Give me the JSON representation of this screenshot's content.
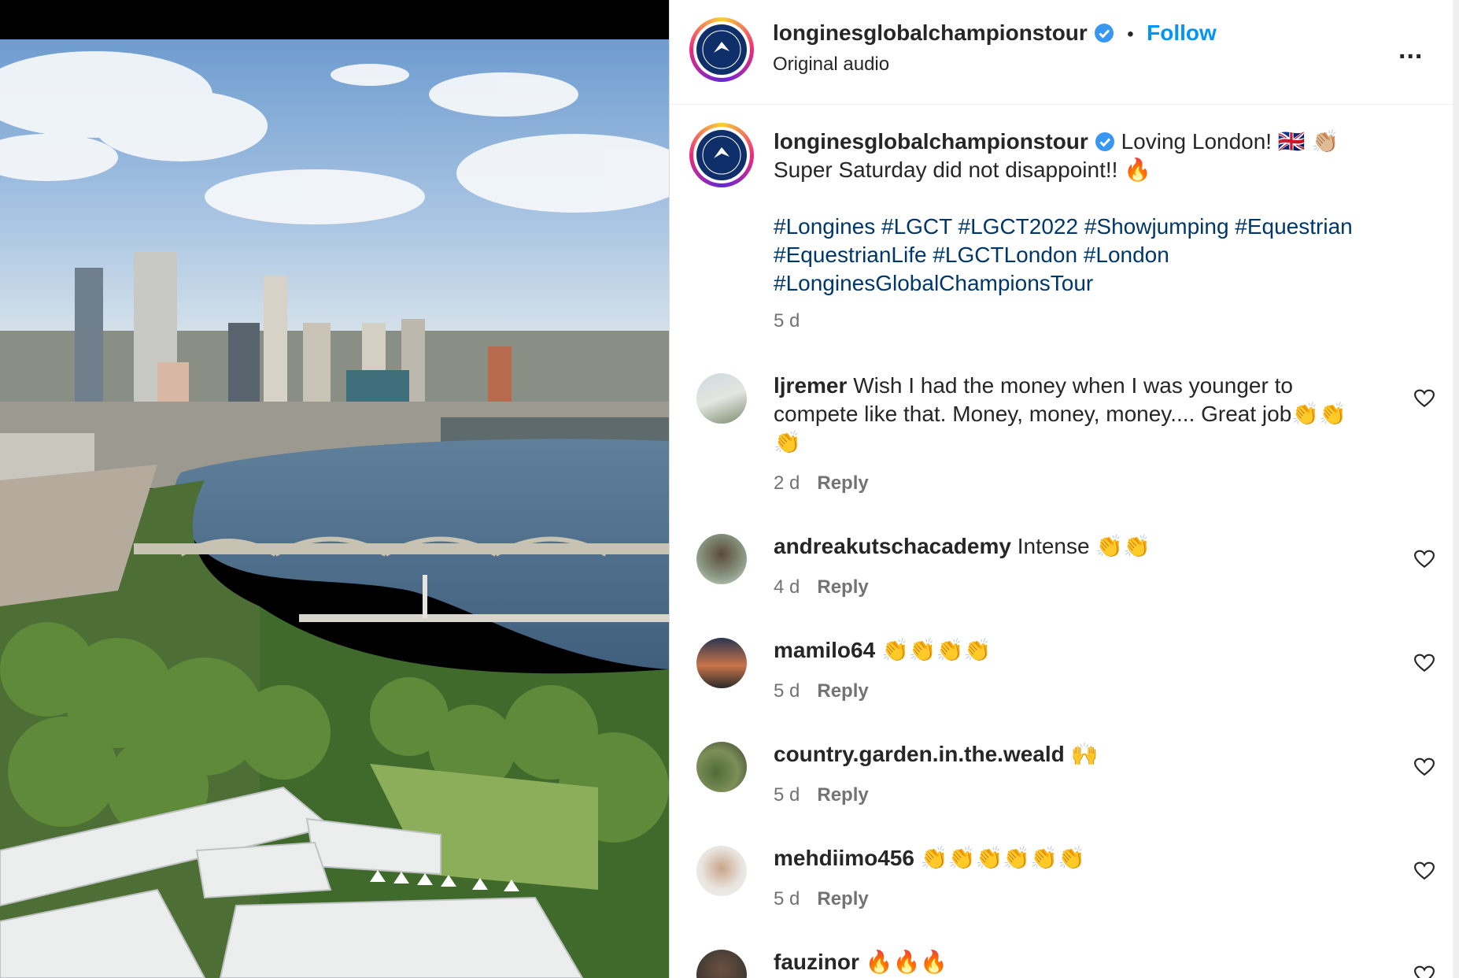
{
  "header": {
    "username": "longinesglobalchampionstour",
    "separator": "•",
    "follow_label": "Follow",
    "audio_label": "Original audio",
    "more_label": "..."
  },
  "caption": {
    "username": "longinesglobalchampionstour",
    "text_line1": "Loving London! 🇬🇧 👏🏼",
    "text_line2": "Super Saturday did not disappoint!! 🔥",
    "hashtags_line1": "#Longines #LGCT #LGCT2022 #Showjumping #Equestrian",
    "hashtags_line2": "#EquestrianLife #LGCTLondon #London",
    "hashtags_line3": "#LonginesGlobalChampionsTour",
    "time": "5 d"
  },
  "comments": [
    {
      "user": "ljremer",
      "text": "Wish I had the money when I was younger to compete like that. Money, money, money.... Great job👏👏👏",
      "time": "2 d",
      "reply": "Reply"
    },
    {
      "user": "andreakutschacademy",
      "text": "Intense 👏👏",
      "time": "4 d",
      "reply": "Reply"
    },
    {
      "user": "mamilo64",
      "text": "👏👏👏👏",
      "time": "5 d",
      "reply": "Reply"
    },
    {
      "user": "country.garden.in.the.weald",
      "text": "🙌",
      "time": "5 d",
      "reply": "Reply"
    },
    {
      "user": "mehdiimo456",
      "text": "👏👏👏👏👏👏",
      "time": "5 d",
      "reply": "Reply"
    },
    {
      "user": "fauzinor",
      "text": "🔥🔥🔥",
      "time": "",
      "reply": ""
    }
  ],
  "colors": {
    "accent": "#0095f6",
    "hashtag": "#00376b",
    "muted": "#737373",
    "verified": "#3897f0"
  },
  "icons": {
    "verified": "verified-badge-icon",
    "more": "more-options-icon",
    "like": "heart-outline-icon"
  }
}
